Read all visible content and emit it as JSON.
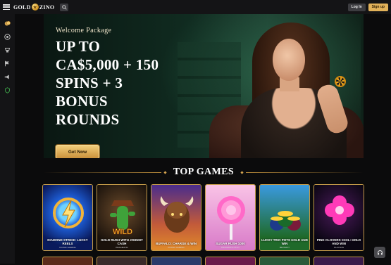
{
  "header": {
    "logo_left": "GOLD",
    "logo_right": "ZINO",
    "login_label": "Log In",
    "signup_label": "Sign up"
  },
  "sidebar": {
    "items": [
      {
        "icon": "coins-icon"
      },
      {
        "icon": "chip-icon"
      },
      {
        "icon": "tournament-icon"
      },
      {
        "icon": "flag-icon"
      },
      {
        "icon": "megaphone-icon"
      },
      {
        "icon": "shield-icon"
      }
    ]
  },
  "hero": {
    "welcome": "Welcome Package",
    "headline_1": "UP TO",
    "headline_2": "CA$5,000 + 150",
    "headline_3": "SPINS + 3",
    "headline_4": "BONUS",
    "headline_5": "ROUNDS",
    "cta_label": "Get Now"
  },
  "section": {
    "title": "TOP GAMES"
  },
  "games": [
    {
      "title": "Diamond Strike: Lucky Reels",
      "provider": "Iconic Gaming",
      "c1": "#0d3bb8",
      "c2": "#0a1a5c"
    },
    {
      "title": "Gold Rush with Johnny Cash",
      "provider": "Pragmatic",
      "c1": "#3b2a1c",
      "c2": "#0f0c09"
    },
    {
      "title": "Buffalo: Charge & Win",
      "provider": "Iconic Gaming",
      "c1": "#4a2c8c",
      "c2": "#e06a2a"
    },
    {
      "title": "Sugar Rush 1000",
      "provider": "Pragmatic Play",
      "c1": "#f7a6d8",
      "c2": "#c85ab8"
    },
    {
      "title": "Lucky Trio Pots Hold and Win",
      "provider": "Betsoft",
      "c1": "#2f8ad0",
      "c2": "#1f6a2a"
    },
    {
      "title": "Pink Clovers XXXL: Hold and Win",
      "provider": "Playson",
      "c1": "#2a0a3a",
      "c2": "#0a0612"
    }
  ],
  "colors": {
    "accent_gold": "#e2b25a",
    "background": "#0b0b0c"
  }
}
